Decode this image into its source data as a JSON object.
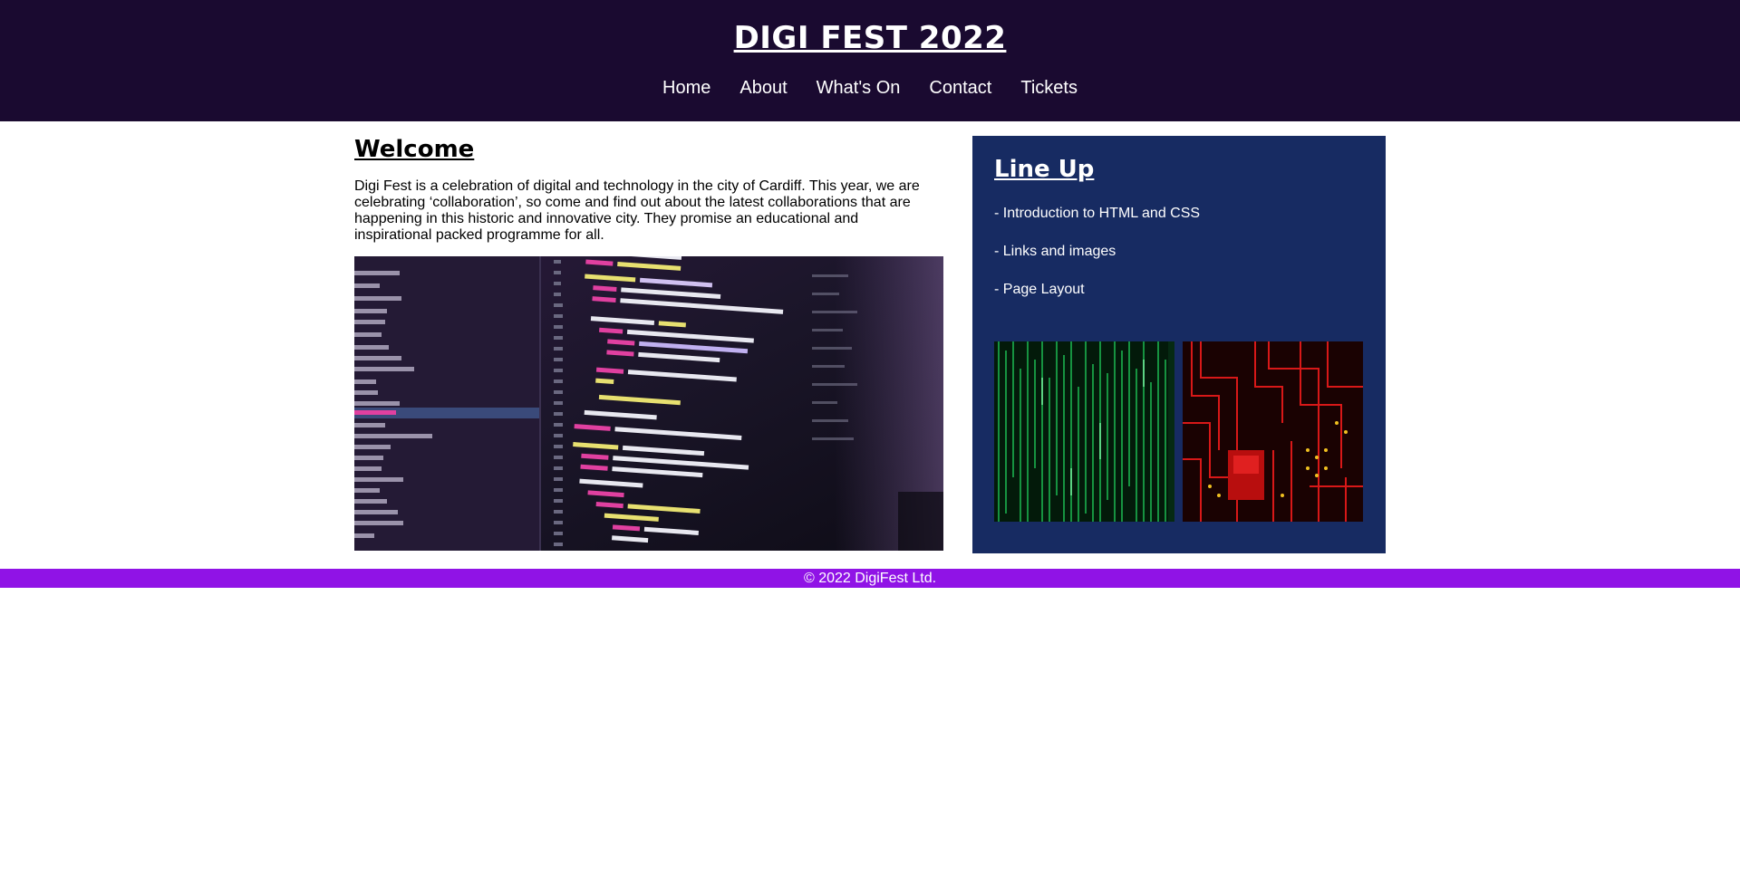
{
  "header": {
    "title": "DIGI FEST 2022",
    "nav": [
      "Home",
      "About",
      "What's On",
      "Contact",
      "Tickets"
    ]
  },
  "welcome": {
    "heading": "Welcome",
    "text": "Digi Fest is a celebration of digital and technology in the city of Cardiff. This year, we are celebrating ‘collaboration’, so come and find out about the latest collaborations that are happening in this historic and innovative city. They promise an educational and inspirational packed programme for all."
  },
  "lineup": {
    "heading": "Line Up",
    "items": [
      "- Introduction to HTML and CSS",
      "- Links and images",
      "- Page Layout"
    ]
  },
  "footer": {
    "text": "© 2022 DigiFest Ltd."
  },
  "colors": {
    "header_bg": "#1a0a30",
    "lineup_bg": "#172b62",
    "footer_bg": "#9013e6"
  }
}
